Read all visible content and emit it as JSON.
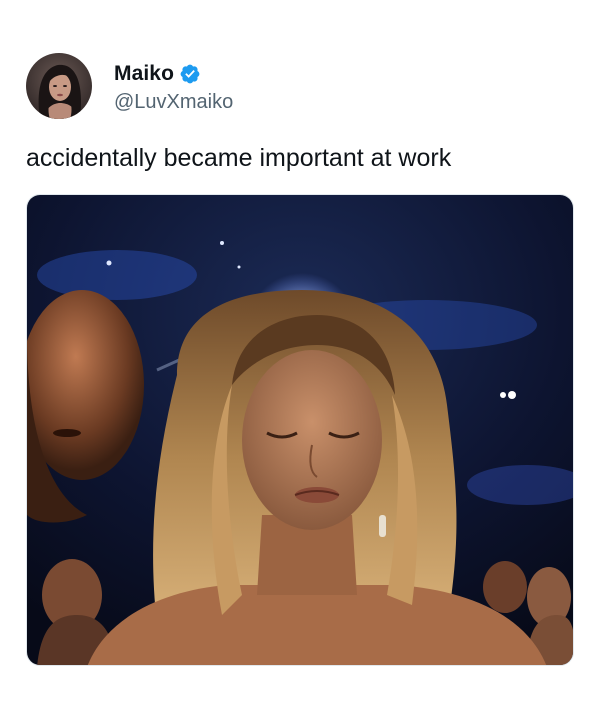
{
  "tweet": {
    "author": {
      "display_name": "Maiko",
      "handle": "@LuvXmaiko",
      "verified": true,
      "avatar_icon": "profile-photo-icon"
    },
    "text": "accidentally became important at work",
    "media": {
      "type": "photo",
      "icon": "photo-icon"
    }
  },
  "colors": {
    "text_primary": "#0f1419",
    "text_secondary": "#536471",
    "verified_blue": "#1d9bf0",
    "background": "#ffffff"
  }
}
